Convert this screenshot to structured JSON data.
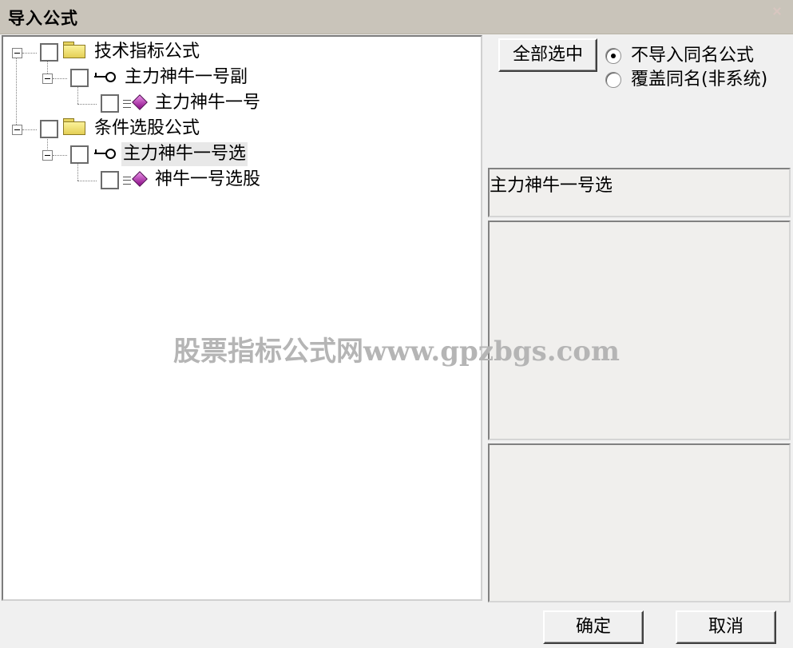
{
  "window": {
    "title": "导入公式"
  },
  "tree": {
    "nodes": [
      {
        "label": "技术指标公式"
      },
      {
        "label": "主力神牛一号副"
      },
      {
        "label": "主力神牛一号"
      },
      {
        "label": "条件选股公式"
      },
      {
        "label": "主力神牛一号选"
      },
      {
        "label": "神牛一号选股"
      }
    ],
    "selected": "主力神牛一号选"
  },
  "select_all_label": "全部选中",
  "import_options": {
    "no_import_same_name": "不导入同名公式",
    "overwrite_same_name": "覆盖同名(非系统)",
    "selected": "不导入同名公式"
  },
  "info_panel": {
    "name": "主力神牛一号选"
  },
  "watermark": "股票指标公式网www.gpzbgs.com",
  "buttons": {
    "ok": "确定",
    "cancel": "取消"
  }
}
